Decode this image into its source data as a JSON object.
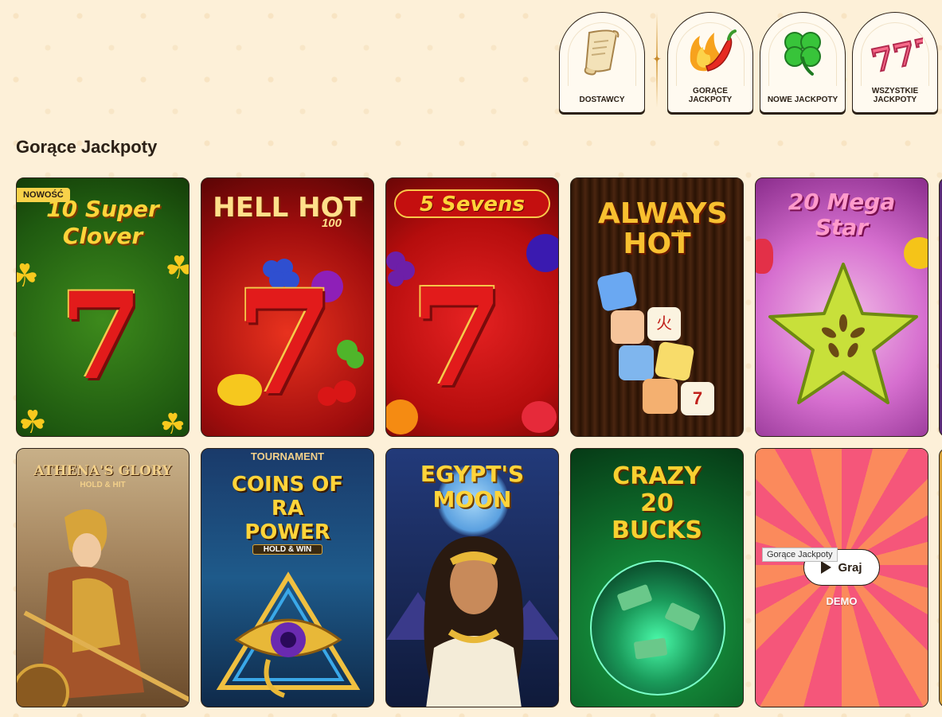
{
  "categories": [
    {
      "label": "DOSTAWCY",
      "icon": "scroll-icon"
    },
    {
      "label": "GORĄCE JACKPOTY",
      "icon": "chili-pepper-icon"
    },
    {
      "label": "NOWE JACKPOTY",
      "icon": "clover-icon"
    },
    {
      "label": "WSZYSTKIE JACKPOTY",
      "icon": "triple-seven-icon"
    }
  ],
  "section": {
    "title": "Gorące Jackpoty"
  },
  "games": [
    {
      "title": "10 Super Clover",
      "badge": "NOWOŚĆ"
    },
    {
      "title": "HELL HOT",
      "subtitle": "100"
    },
    {
      "title": "5 Sevens"
    },
    {
      "title": "ALWAYS HOT",
      "tm": "™"
    },
    {
      "title": "20 Mega Star"
    },
    {
      "title": "ATHENA'S GLORY",
      "subtitle": "HOLD & HIT"
    },
    {
      "title": "COINS OF RA POWER",
      "header": "TOURNAMENT",
      "subtitle": "HOLD & WIN"
    },
    {
      "title": "EGYPT'S MOON"
    },
    {
      "title": "CRAZY 20 BUCKS"
    },
    {
      "play_label": "Graj",
      "demo_label": "DEMO",
      "tooltip": "Gorące Jackpoty"
    }
  ],
  "colors": {
    "background": "#fdf0d8",
    "text": "#2b2016",
    "badge": "#f8d24a"
  }
}
